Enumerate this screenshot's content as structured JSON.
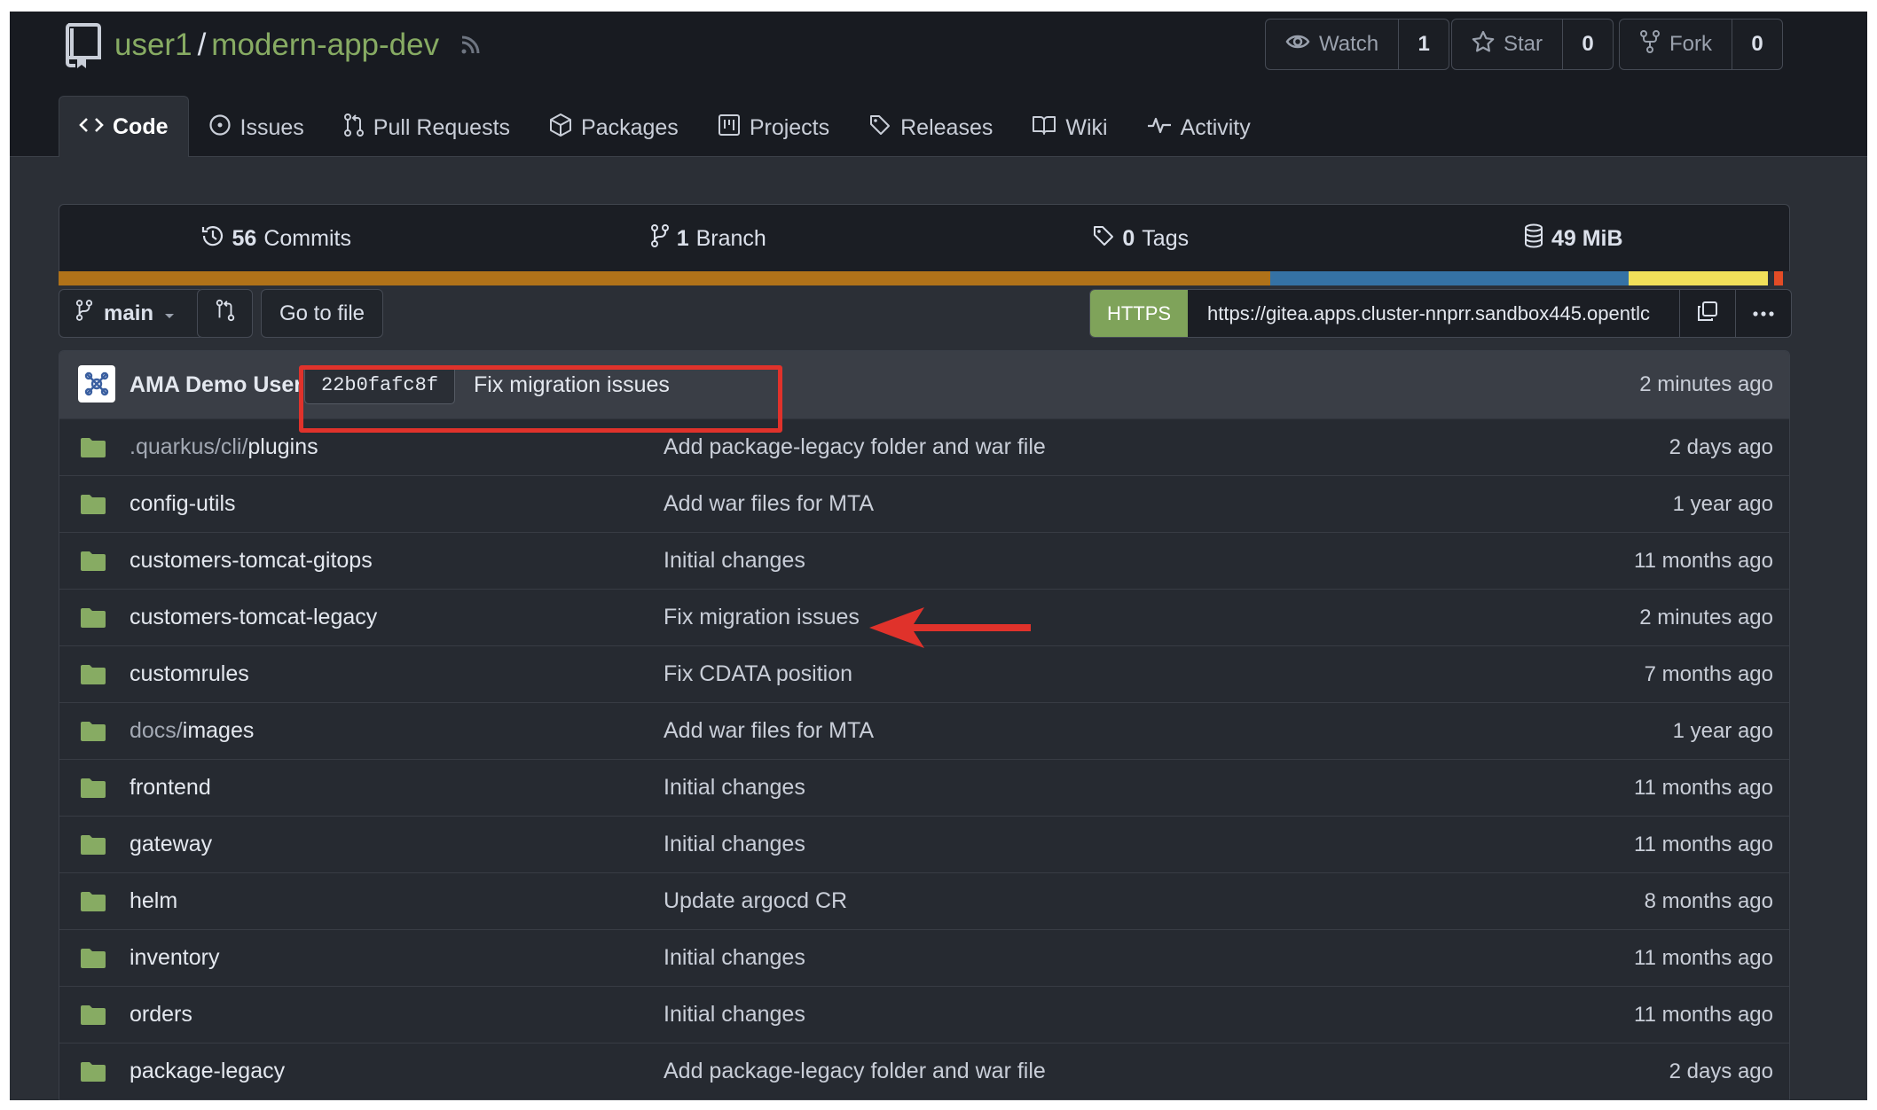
{
  "repo": {
    "owner": "user1",
    "separator": "/",
    "name": "modern-app-dev"
  },
  "actions": {
    "watch": {
      "label": "Watch",
      "count": "1"
    },
    "star": {
      "label": "Star",
      "count": "0"
    },
    "fork": {
      "label": "Fork",
      "count": "0"
    }
  },
  "tabs": [
    {
      "label": "Code",
      "icon": "code-icon",
      "active": true
    },
    {
      "label": "Issues",
      "icon": "issue-icon"
    },
    {
      "label": "Pull Requests",
      "icon": "pull-request-icon"
    },
    {
      "label": "Packages",
      "icon": "package-icon"
    },
    {
      "label": "Projects",
      "icon": "project-icon"
    },
    {
      "label": "Releases",
      "icon": "tag-icon"
    },
    {
      "label": "Wiki",
      "icon": "book-icon"
    },
    {
      "label": "Activity",
      "icon": "pulse-icon"
    }
  ],
  "stats": {
    "commits": {
      "value": "56",
      "label": "Commits"
    },
    "branches": {
      "value": "1",
      "label": "Branch"
    },
    "tags": {
      "value": "0",
      "label": "Tags"
    },
    "size": {
      "value": "49 MiB"
    }
  },
  "languages": [
    {
      "color": "#b07219",
      "fraction": 0.7
    },
    {
      "color": "#3572a5",
      "fraction": 0.207
    },
    {
      "color": "#f1e05a",
      "fraction": 0.08
    },
    {
      "color": "#2b2f36",
      "fraction": 0.004
    },
    {
      "color": "#e34c26",
      "fraction": 0.005
    },
    {
      "color": "#2b2f36",
      "fraction": 0.004
    }
  ],
  "controls": {
    "branch": "main",
    "go_to_file": "Go to file",
    "clone_protocol": "HTTPS",
    "clone_url": "https://gitea.apps.cluster-nnprr.sandbox445.opentlc"
  },
  "latest_commit": {
    "author": "AMA Demo User",
    "sha": "22b0fafc8f",
    "message": "Fix migration issues",
    "time": "2 minutes ago"
  },
  "files": [
    {
      "prefix": ".quarkus/cli/",
      "name": "plugins",
      "message": "Add package-legacy folder and war file",
      "time": "2 days ago"
    },
    {
      "prefix": "",
      "name": "config-utils",
      "message": "Add war files for MTA",
      "time": "1 year ago"
    },
    {
      "prefix": "",
      "name": "customers-tomcat-gitops",
      "message": "Initial changes",
      "time": "11 months ago"
    },
    {
      "prefix": "",
      "name": "customers-tomcat-legacy",
      "message": "Fix migration issues",
      "time": "2 minutes ago"
    },
    {
      "prefix": "",
      "name": "customrules",
      "message": "Fix CDATA position",
      "time": "7 months ago"
    },
    {
      "prefix": "docs/",
      "name": "images",
      "message": "Add war files for MTA",
      "time": "1 year ago"
    },
    {
      "prefix": "",
      "name": "frontend",
      "message": "Initial changes",
      "time": "11 months ago"
    },
    {
      "prefix": "",
      "name": "gateway",
      "message": "Initial changes",
      "time": "11 months ago"
    },
    {
      "prefix": "",
      "name": "helm",
      "message": "Update argocd CR",
      "time": "8 months ago"
    },
    {
      "prefix": "",
      "name": "inventory",
      "message": "Initial changes",
      "time": "11 months ago"
    },
    {
      "prefix": "",
      "name": "orders",
      "message": "Initial changes",
      "time": "11 months ago"
    },
    {
      "prefix": "",
      "name": "package-legacy",
      "message": "Add package-legacy folder and war file",
      "time": "2 days ago"
    }
  ],
  "colors": {
    "accent": "#87ab63",
    "annotation": "#e0322b",
    "folder": "#87ab63"
  }
}
